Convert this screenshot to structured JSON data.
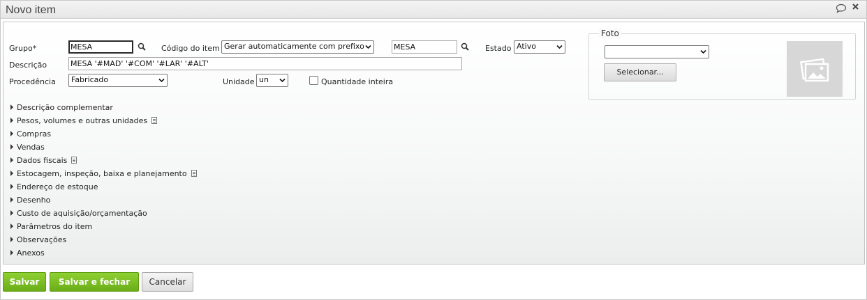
{
  "window": {
    "title": "Novo item",
    "icons": [
      "chat-icon",
      "close-icon"
    ]
  },
  "form": {
    "grupo": {
      "label": "Grupo*",
      "value": "MESA"
    },
    "codigo": {
      "label": "Código do item",
      "mode": "Gerar automaticamente com prefixo",
      "prefix": "MESA"
    },
    "estado": {
      "label": "Estado",
      "value": "Ativo"
    },
    "descricao": {
      "label": "Descrição",
      "value": "MESA '#MAD' '#COM' '#LAR' '#ALT'"
    },
    "procedencia": {
      "label": "Procedência",
      "value": "Fabricado"
    },
    "unidade": {
      "label": "Unidade",
      "value": "un"
    },
    "quantidade_inteira": {
      "label": "Quantidade inteira",
      "checked": false
    }
  },
  "foto": {
    "legend": "Foto",
    "select_value": "",
    "button_label": "Selecionar..."
  },
  "sections": [
    {
      "label": "Descrição complementar",
      "doc_icon": false
    },
    {
      "label": "Pesos, volumes e outras unidades",
      "doc_icon": true
    },
    {
      "label": "Compras",
      "doc_icon": false
    },
    {
      "label": "Vendas",
      "doc_icon": false
    },
    {
      "label": "Dados fiscais",
      "doc_icon": true
    },
    {
      "label": "Estocagem, inspeção, baixa e planejamento",
      "doc_icon": true
    },
    {
      "label": "Endereço de estoque",
      "doc_icon": false
    },
    {
      "label": "Desenho",
      "doc_icon": false
    },
    {
      "label": "Custo de aquisição/orçamentação",
      "doc_icon": false
    },
    {
      "label": "Parâmetros do item",
      "doc_icon": false
    },
    {
      "label": "Observações",
      "doc_icon": false
    },
    {
      "label": "Anexos",
      "doc_icon": false
    }
  ],
  "footer": {
    "save": "Salvar",
    "save_close": "Salvar e fechar",
    "cancel": "Cancelar"
  },
  "colors": {
    "primary_button": "#78bb1f",
    "title_text": "#444444"
  }
}
